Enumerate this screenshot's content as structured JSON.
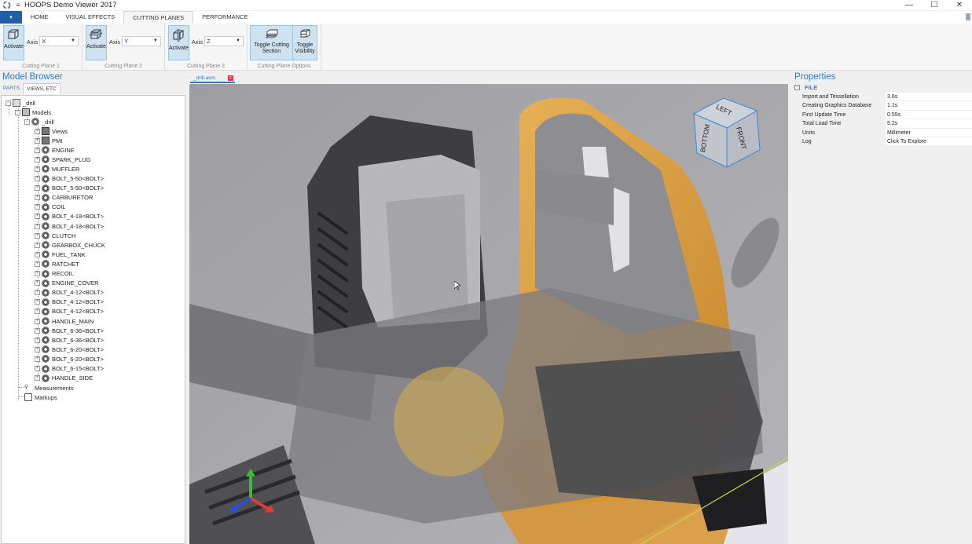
{
  "window": {
    "title": "HOOPS Demo Viewer 2017",
    "controls": {
      "minimize": "—",
      "maximize": "☐",
      "close": "✕"
    }
  },
  "ribbon": {
    "file_tab": "▾",
    "tabs": [
      {
        "label": "HOME",
        "active": false
      },
      {
        "label": "VISUAL EFFECTS",
        "active": false
      },
      {
        "label": "CUTTING PLANES",
        "active": true
      },
      {
        "label": "PERFORMANCE",
        "active": false
      }
    ],
    "groups": [
      {
        "label": "Cutting Plane 1",
        "button": "Activate",
        "axis_label": "Axis",
        "axis_value": "X"
      },
      {
        "label": "Cutting Plane 2",
        "button": "Activate",
        "axis_label": "Axis",
        "axis_value": "Y"
      },
      {
        "label": "Cutting Plane 3",
        "button": "Activate",
        "axis_label": "Axis",
        "axis_value": "Z"
      }
    ],
    "options_group": {
      "label": "Cutting Plane Options",
      "toggle_section": "Toggle Cutting Section",
      "toggle_visibility": "Toggle Visibility"
    }
  },
  "model_browser": {
    "title": "Model Browser",
    "tabs": [
      "PARTS",
      "VIEWS, ETC"
    ],
    "tree": {
      "root": "_drill",
      "models": "Models",
      "assembly": "_drill",
      "children": [
        "Views",
        "PMI",
        "ENGINE",
        "SPARK_PLUG",
        "MUFFLER",
        "BOLT_5-50<BOLT>",
        "BOLT_5-50<BOLT>",
        "CARBURETOR",
        "COIL",
        "BOLT_4-18<BOLT>",
        "BOLT_4-18<BOLT>",
        "CLUTCH",
        "GEARBOX_CHUCK",
        "FUEL_TANK",
        "RATCHET",
        "RECOIL",
        "ENGINE_COVER",
        "BOLT_4-12<BOLT>",
        "BOLT_4-12<BOLT>",
        "BOLT_4-12<BOLT>",
        "HANDLE_MAIN",
        "BOLT_6-36<BOLT>",
        "BOLT_6-36<BOLT>",
        "BOLT_6-20<BOLT>",
        "BOLT_6-20<BOLT>",
        "BOLT_6-15<BOLT>",
        "HANDLE_SIDE"
      ],
      "measurements": "Measurements",
      "markups": "Markups"
    }
  },
  "viewport": {
    "document_tab": "_drill.asm",
    "close_label": "x",
    "view_cube": {
      "top": "LEFT",
      "left": "BOTTOM",
      "right": "FRONT"
    }
  },
  "properties": {
    "title": "Properties",
    "category": "FILE",
    "rows": [
      {
        "name": "Import and Tessellation",
        "value": "3.6s"
      },
      {
        "name": "Creating Graphics Database",
        "value": "1.1s"
      },
      {
        "name": "First Update Time",
        "value": "0.55s"
      },
      {
        "name": "Total Load Time",
        "value": "5.2s"
      },
      {
        "name": "Units",
        "value": "Millimeter"
      },
      {
        "name": "Log",
        "value": "Click To Explore"
      }
    ]
  },
  "colors": {
    "accent": "#2d7ac9",
    "file_tab": "#1e5fa8",
    "model_orange": "#e59a2a",
    "axis_x": "#e23b3b",
    "axis_y": "#3fb83f",
    "axis_z": "#2a4fd6"
  }
}
